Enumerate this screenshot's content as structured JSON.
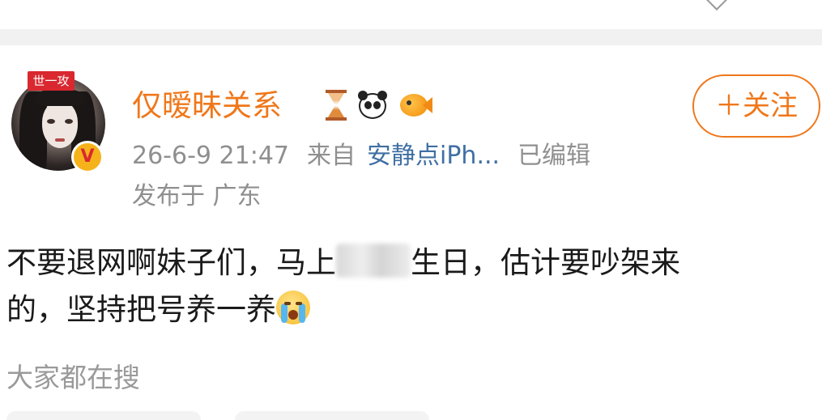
{
  "post": {
    "avatar_tag": "世一攻",
    "vip_badge": "V",
    "username": "仅暧昧关系",
    "user_badges": [
      "hourglass-icon",
      "panda-icon",
      "fish-icon"
    ],
    "follow_button": "＋关注",
    "time": "26-6-9 21:47",
    "from_label": "来自",
    "source": "安静点iPh...",
    "edited": "已编辑",
    "location": "发布于 广东",
    "content_line1_a": "不要退网啊妹子们，马上",
    "content_line1_b": "生日，估计要吵架来",
    "content_line2": "的，坚持把号养一养",
    "content_emoji": "crying-face-icon"
  },
  "search_section": {
    "label": "大家都在搜"
  },
  "colors": {
    "accent_orange": "#f0771a",
    "link_blue": "#3f6fa3",
    "meta_gray": "#8f8f8f",
    "vip_red": "#d9282f",
    "vip_gold": "#f6b21a"
  }
}
